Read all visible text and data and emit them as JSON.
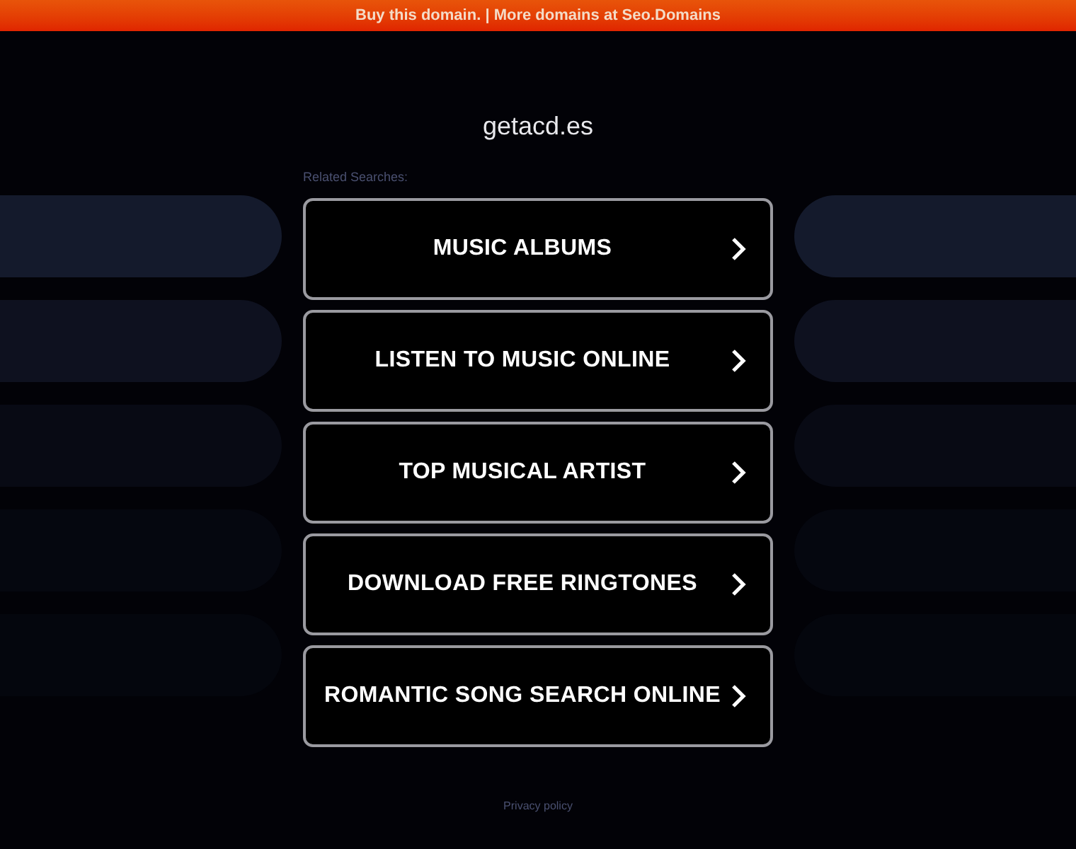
{
  "banner": {
    "text": "Buy this domain. | More domains at Seo.Domains"
  },
  "site_title": "getacd.es",
  "related_heading": "Related Searches:",
  "links": [
    {
      "label": "MUSIC ALBUMS"
    },
    {
      "label": "LISTEN TO MUSIC ONLINE"
    },
    {
      "label": "TOP MUSICAL ARTIST"
    },
    {
      "label": "DOWNLOAD FREE RINGTONES"
    },
    {
      "label": "ROMANTIC SONG SEARCH ONLINE"
    }
  ],
  "footer_link": "Privacy policy"
}
